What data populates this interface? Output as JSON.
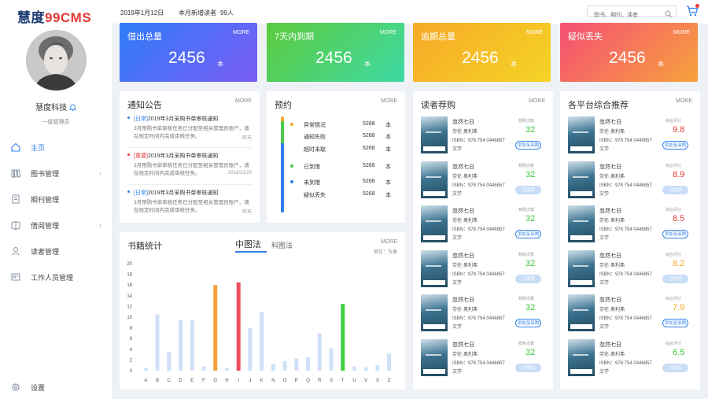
{
  "app": {
    "logo_a": "慧度",
    "logo_b": "99CMS"
  },
  "user": {
    "name": "慧度科技",
    "role": "一级管理员"
  },
  "nav": [
    {
      "label": "主页",
      "icon": "home-icon",
      "active": true,
      "arrow": ""
    },
    {
      "label": "图书管理",
      "icon": "books-icon",
      "active": false,
      "arrow": "›"
    },
    {
      "label": "期刊管理",
      "icon": "journal-icon",
      "active": false,
      "arrow": ""
    },
    {
      "label": "借阅管理",
      "icon": "borrow-icon",
      "active": false,
      "arrow": "›"
    },
    {
      "label": "读者管理",
      "icon": "reader-icon",
      "active": false,
      "arrow": ""
    },
    {
      "label": "工作人员管理",
      "icon": "staff-icon",
      "active": false,
      "arrow": ""
    }
  ],
  "settings_label": "设置",
  "topbar": {
    "date": "2019年1月12日",
    "new_readers_label": "本月新增读者",
    "new_readers_value": "99人",
    "search_placeholder": "图书、期刊、读者"
  },
  "stats": [
    {
      "title": "借出总量",
      "more": "MORE",
      "value": "2456",
      "unit": "本",
      "color_from": "#2f7df7",
      "color_to": "#7b5cf5"
    },
    {
      "title": "7天内到期",
      "more": "MORE",
      "value": "2456",
      "unit": "本",
      "color_from": "#5ccb3e",
      "color_to": "#3fd9a4"
    },
    {
      "title": "逾期总量",
      "more": "MORE",
      "value": "2456",
      "unit": "本",
      "color_from": "#f7a928",
      "color_to": "#f4d426"
    },
    {
      "title": "疑似丢失",
      "more": "MORE",
      "value": "2456",
      "unit": "本",
      "color_from": "#f44f74",
      "color_to": "#f7a23c"
    }
  ],
  "notice": {
    "title": "通知公告",
    "more": "MORE",
    "items": [
      {
        "tag": "[日常]",
        "tag_color": "#2f80ed",
        "headline": "2019年3月采购书单审核通知",
        "body": "3月预购书单审核任务已分配至相关管理员账户，请在规定时间内完成审核任务。",
        "date": "昨天"
      },
      {
        "tag": "[重要]",
        "tag_color": "#e53935",
        "headline": "2019年3月采购书单审核通知",
        "body": "3月预购书单审核任务已分配至相关管理员账户，请在规定时间内完成审核任务。",
        "date": "2018/12/29"
      },
      {
        "tag": "[日常]",
        "tag_color": "#2f80ed",
        "headline": "2019年3月采购书单审核通知",
        "body": "3月预购书单审核任务已分配至相关管理员账户，请在规定时间内完成审核任务。",
        "date": "昨天"
      }
    ]
  },
  "reserve": {
    "title": "预约",
    "more": "MORE",
    "rows": [
      {
        "label": "异常情况",
        "count": "5268",
        "unit": "本",
        "dot": "#f7a928"
      },
      {
        "label": "通知失败",
        "count": "5268",
        "unit": "本",
        "dot": ""
      },
      {
        "label": "超时未取",
        "count": "5268",
        "unit": "本",
        "dot": ""
      },
      {
        "label": "已到馆",
        "count": "5268",
        "unit": "本",
        "dot": "#4cc94c"
      },
      {
        "label": "未到馆",
        "count": "5268",
        "unit": "本",
        "dot": "#2f80ed"
      },
      {
        "label": "疑似丢失",
        "count": "5268",
        "unit": "本",
        "dot": ""
      }
    ]
  },
  "reader_rec": {
    "title": "读者荐购",
    "more": "MORE",
    "books": [
      {
        "title": "忽然七日",
        "author": "劳伦·奥利弗",
        "isbn": "ISBN：978 754 0446857",
        "category": "文学",
        "score_label": "荐购次数",
        "score": "32",
        "button": "添加至采购",
        "added": false
      },
      {
        "title": "忽然七日",
        "author": "劳伦·奥利弗",
        "isbn": "ISBN：978 754 0446857",
        "category": "文学",
        "score_label": "荐购次数",
        "score": "32",
        "button": "已添加",
        "added": true
      },
      {
        "title": "忽然七日",
        "author": "劳伦·奥利弗",
        "isbn": "ISBN：978 754 0446857",
        "category": "文学",
        "score_label": "荐购次数",
        "score": "32",
        "button": "添加至采购",
        "added": false
      },
      {
        "title": "忽然七日",
        "author": "劳伦·奥利弗",
        "isbn": "ISBN：978 754 0446857",
        "category": "文学",
        "score_label": "荐购次数",
        "score": "32",
        "button": "已添加",
        "added": true
      },
      {
        "title": "忽然七日",
        "author": "劳伦·奥利弗",
        "isbn": "ISBN：978 754 0446857",
        "category": "文学",
        "score_label": "荐购次数",
        "score": "32",
        "button": "添加至采购",
        "added": false
      },
      {
        "title": "忽然七日",
        "author": "劳伦·奥利弗",
        "isbn": "ISBN：978 754 0446857",
        "category": "文学",
        "score_label": "荐购次数",
        "score": "32",
        "button": "已添加",
        "added": true
      }
    ]
  },
  "platform_rec": {
    "title": "各平台综合推荐",
    "more": "MORE",
    "books": [
      {
        "title": "忽然七日",
        "author": "劳伦·奥利弗",
        "isbn": "ISBN：978 754 0446857",
        "category": "文学",
        "score_label": "综合评分",
        "score": "9.8",
        "score_color": "#e53935",
        "button": "添加至采购",
        "added": false
      },
      {
        "title": "忽然七日",
        "author": "劳伦·奥利弗",
        "isbn": "ISBN：978 754 0446857",
        "category": "文学",
        "score_label": "综合评分",
        "score": "8.9",
        "score_color": "#e53935",
        "button": "已添加",
        "added": true
      },
      {
        "title": "忽然七日",
        "author": "劳伦·奥利弗",
        "isbn": "ISBN：978 754 0446857",
        "category": "文学",
        "score_label": "综合评分",
        "score": "8.5",
        "score_color": "#e53935",
        "button": "添加至采购",
        "added": false
      },
      {
        "title": "忽然七日",
        "author": "劳伦·奥利弗",
        "isbn": "ISBN：978 754 0446857",
        "category": "文学",
        "score_label": "综合评分",
        "score": "8.2",
        "score_color": "#f7a928",
        "button": "已添加",
        "added": true
      },
      {
        "title": "忽然七日",
        "author": "劳伦·奥利弗",
        "isbn": "ISBN：978 754 0446857",
        "category": "文学",
        "score_label": "综合评分",
        "score": "7.9",
        "score_color": "#f7a928",
        "button": "添加至采购",
        "added": false
      },
      {
        "title": "忽然七日",
        "author": "劳伦·奥利弗",
        "isbn": "ISBN：978 754 0446857",
        "category": "文学",
        "score_label": "综合评分",
        "score": "6.5",
        "score_color": "#3cc43c",
        "button": "已添加",
        "added": true
      }
    ]
  },
  "book_stats": {
    "title": "书籍统计",
    "tab_active": "中图法",
    "tab_other": "科图法",
    "more": "MORE",
    "unit": "单位：万册"
  },
  "chart_data": {
    "type": "bar",
    "categories": [
      "A",
      "B",
      "C",
      "D",
      "E",
      "F",
      "G",
      "H",
      "I",
      "J",
      "K",
      "N",
      "O",
      "P",
      "Q",
      "R",
      "S",
      "T",
      "U",
      "V",
      "X",
      "Z"
    ],
    "values": [
      0.5,
      10.5,
      3.5,
      9.5,
      9.5,
      0.8,
      16,
      0.5,
      16.5,
      8,
      11,
      1.2,
      1.8,
      2.3,
      2.5,
      7,
      4.2,
      12.5,
      0.8,
      0.6,
      1,
      3.2
    ],
    "colors": [
      "#cfe0f7",
      "#cfe0f7",
      "#cfe0f7",
      "#cfe0f7",
      "#cfe0f7",
      "#cfe0f7",
      "#f7a23c",
      "#cfe0f7",
      "#ef4f5a",
      "#cfe0f7",
      "#cfe0f7",
      "#cfe0f7",
      "#cfe0f7",
      "#cfe0f7",
      "#cfe0f7",
      "#cfe0f7",
      "#cfe0f7",
      "#3fcf3f",
      "#cfe0f7",
      "#cfe0f7",
      "#cfe0f7",
      "#cfe0f7"
    ],
    "yticks": [
      0,
      2,
      4,
      6,
      8,
      10,
      12,
      14,
      16,
      18,
      20
    ],
    "ylim": [
      0,
      20
    ],
    "title": "",
    "xlabel": "",
    "ylabel": ""
  }
}
